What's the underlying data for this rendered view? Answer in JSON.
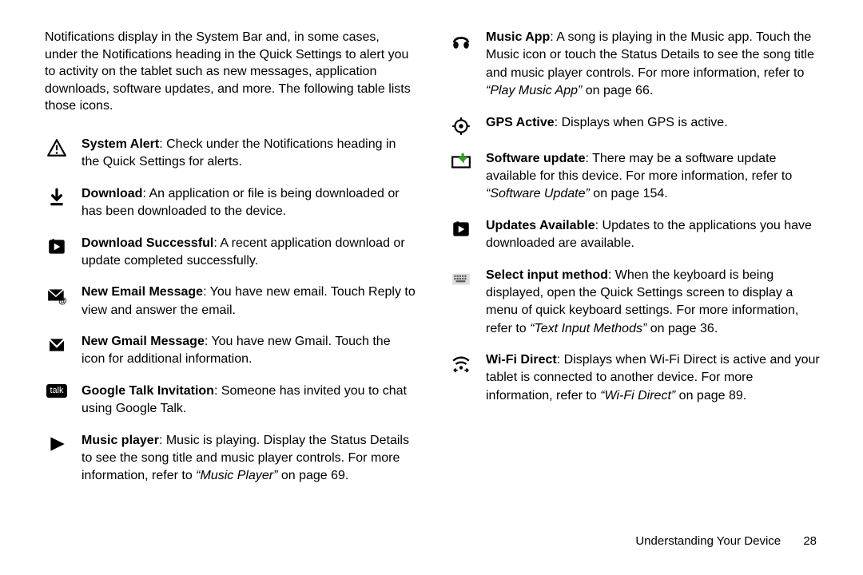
{
  "intro": "Notifications display in the System Bar and, in some cases, under the Notifications heading in the Quick Settings to alert you to activity on the tablet such as new messages, application downloads, software updates, and more. The following table lists those icons.",
  "left": [
    {
      "title": "System Alert",
      "body": ": Check under the Notifications heading in the Quick Settings for alerts."
    },
    {
      "title": "Download",
      "body": ": An application or file is being downloaded or has been downloaded to the device."
    },
    {
      "title": "Download Successful",
      "body": ": A recent application download or update completed successfully."
    },
    {
      "title": "New Email Message",
      "body": ": You have new email. Touch Reply to view and answer the email."
    },
    {
      "title": "New Gmail Message",
      "body": ": You have new Gmail. Touch the icon for additional information."
    },
    {
      "title": "Google Talk Invitation",
      "body": ": Someone has invited you to chat using Google Talk."
    },
    {
      "title": "Music player",
      "body": ": Music is playing. Display the Status Details to see the song title and music player controls. For more information, refer to ",
      "refItalic": "“Music Player”",
      "refTail": " on page 69."
    }
  ],
  "right": [
    {
      "title": "Music App",
      "body": ": A song is playing in the Music app. Touch the Music icon or touch the Status Details to see the song title and music player controls. For more information, refer to ",
      "refItalic": "“Play Music App”",
      "refTail": " on page 66."
    },
    {
      "title": "GPS Active",
      "body": ": Displays when GPS is active."
    },
    {
      "title": "Software update",
      "body": ": There may be a software update available for this device. For more information, refer to ",
      "refItalic": "“Software Update”",
      "refTail": " on page 154."
    },
    {
      "title": "Updates Available",
      "body": ": Updates to the applications you have downloaded are available."
    },
    {
      "title": "Select input method",
      "body": ": When the keyboard is being displayed, open the Quick Settings screen to display a menu of quick keyboard settings. For more information, refer to ",
      "refItalic": "“Text Input Methods”",
      "refTail": " on page 36."
    },
    {
      "title": "Wi-Fi Direct",
      "body": ": Displays when Wi-Fi Direct is active and your tablet is connected to another device. For more information, refer to ",
      "refItalic": "“Wi-Fi Direct”",
      "refTail": " on page 89."
    }
  ],
  "footer": {
    "section": "Understanding Your Device",
    "page": "28"
  },
  "talkLabel": "talk"
}
